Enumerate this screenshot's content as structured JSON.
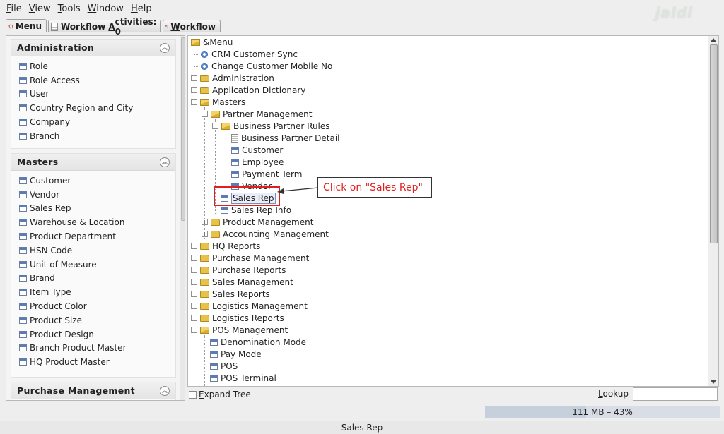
{
  "menubar": {
    "items": [
      {
        "label_u": "F",
        "label_rest": "ile"
      },
      {
        "label_u": "V",
        "label_rest": "iew"
      },
      {
        "label_u": "T",
        "label_rest": "ools"
      },
      {
        "label_u": "W",
        "label_rest": "indow"
      },
      {
        "label_u": "H",
        "label_rest": "elp"
      }
    ],
    "brand": "jaldi"
  },
  "tabs": {
    "menu_u": "M",
    "menu_rest": "enu",
    "workflow_activities_pre": "Workflow ",
    "workflow_activities_u": "A",
    "workflow_activities_rest": "ctivities: 0",
    "workflow_u": "W",
    "workflow_rest": "orkflow"
  },
  "left_panel": {
    "groups": [
      {
        "title": "Administration",
        "items": [
          "Role",
          "Role Access",
          "User",
          "Country Region and City",
          "Company",
          "Branch"
        ]
      },
      {
        "title": "Masters",
        "items": [
          "Customer",
          "Vendor",
          "Sales Rep",
          "Warehouse & Location",
          "Product Department",
          "HSN Code",
          "Unit of Measure",
          "Brand",
          "Item Type",
          "Product Color",
          "Product Size",
          "Product Design",
          "Branch Product Master",
          "HQ Product Master"
        ]
      },
      {
        "title": "Purchase Management",
        "items": []
      }
    ]
  },
  "tree": {
    "root": "&Menu",
    "nodes": [
      "CRM Customer Sync",
      "Change Customer Mobile No",
      "Administration",
      "Application Dictionary",
      "Masters",
      "Partner Management",
      "Business Partner Rules",
      "Business Partner Detail",
      "Customer",
      "Employee",
      "Payment Term",
      "Vendor",
      "Sales Rep",
      "Sales Rep Info",
      "Product Management",
      "Accounting Management",
      "HQ Reports",
      "Purchase Management",
      "Purchase Reports",
      "Sales Management",
      "Sales Reports",
      "Logistics Management",
      "Logistics Reports",
      "POS Management",
      "Denomination Mode",
      "Pay Mode",
      "POS",
      "POS Terminal"
    ]
  },
  "annotation": {
    "text": "Click on \"Sales Rep\"",
    "highlight_color": "#e02020"
  },
  "footer": {
    "expand_u": "E",
    "expand_rest": "xpand Tree",
    "lookup_u": "L",
    "lookup_rest": "ookup",
    "lookup_value": ""
  },
  "memory": {
    "text": "111 MB – 43%",
    "fraction": 0.43
  },
  "status": {
    "text": "Sales Rep"
  }
}
